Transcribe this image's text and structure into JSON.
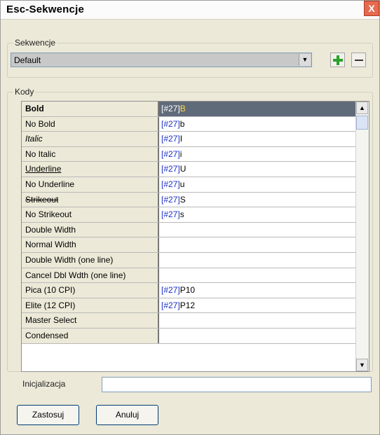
{
  "window": {
    "title": "Esc-Sekwencje",
    "close_symbol": "X"
  },
  "sekwencje": {
    "legend": "Sekwencje",
    "selected": "Default",
    "arrow_symbol": "▼",
    "add_icon": "plus-icon",
    "remove_icon": "minus-icon"
  },
  "kody": {
    "legend": "Kody",
    "rows": [
      {
        "name": "Bold",
        "prefix": "[#27]",
        "suffix": "B",
        "style": "bold",
        "highlight": true
      },
      {
        "name": "No Bold",
        "prefix": "[#27]",
        "suffix": "b"
      },
      {
        "name": "Italic",
        "prefix": "[#27]",
        "suffix": "I",
        "style": "italic"
      },
      {
        "name": "No Italic",
        "prefix": "[#27]",
        "suffix": "i"
      },
      {
        "name": "Underline",
        "prefix": "[#27]",
        "suffix": "U",
        "style": "underline"
      },
      {
        "name": "No Underline",
        "prefix": "[#27]",
        "suffix": "u"
      },
      {
        "name": "Strikeout",
        "prefix": "[#27]",
        "suffix": "S",
        "style": "strike"
      },
      {
        "name": "No Strikeout",
        "prefix": "[#27]",
        "suffix": "s"
      },
      {
        "name": "Double Width",
        "prefix": "",
        "suffix": ""
      },
      {
        "name": "Normal Width",
        "prefix": "",
        "suffix": ""
      },
      {
        "name": "Double Width (one line)",
        "prefix": "",
        "suffix": ""
      },
      {
        "name": "Cancel Dbl Wdth (one line)",
        "prefix": "",
        "suffix": ""
      },
      {
        "name": "Pica (10 CPI)",
        "prefix": "[#27]",
        "suffix": "P10"
      },
      {
        "name": "Elite (12 CPI)",
        "prefix": "[#27]",
        "suffix": "P12"
      },
      {
        "name": "Master Select",
        "prefix": "",
        "suffix": ""
      },
      {
        "name": "Condensed",
        "prefix": "",
        "suffix": ""
      }
    ]
  },
  "init": {
    "label": "Inicjalizacja",
    "value": ""
  },
  "buttons": {
    "apply": "Zastosuj",
    "cancel": "Anuluj"
  },
  "colors": {
    "highlight_bg": "#606b7a",
    "prefix_color": "#1a2fc7",
    "highlight_suffix": "#ffd84a"
  }
}
